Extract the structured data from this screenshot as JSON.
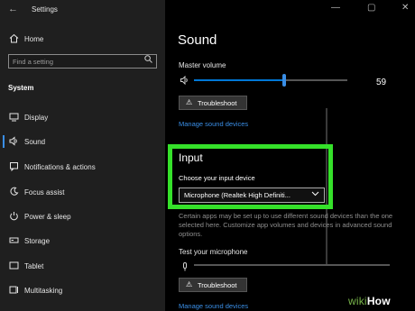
{
  "app": {
    "title": "Settings",
    "back_icon": "back-arrow-icon"
  },
  "window_controls": [
    "—",
    "▢",
    "✕"
  ],
  "sidebar": {
    "home": {
      "label": "Home",
      "icon": "home-icon"
    },
    "search": {
      "placeholder": "Find a setting",
      "icon": "search-icon"
    },
    "section_heading": "System",
    "items": [
      {
        "label": "Display",
        "icon": "display-icon",
        "active": false
      },
      {
        "label": "Sound",
        "icon": "speaker-icon",
        "active": true
      },
      {
        "label": "Notifications & actions",
        "icon": "notifications-icon",
        "active": false
      },
      {
        "label": "Focus assist",
        "icon": "focus-assist-icon",
        "active": false
      },
      {
        "label": "Power & sleep",
        "icon": "power-icon",
        "active": false
      },
      {
        "label": "Storage",
        "icon": "storage-icon",
        "active": false
      },
      {
        "label": "Tablet",
        "icon": "tablet-icon",
        "active": false
      },
      {
        "label": "Multitasking",
        "icon": "multitasking-icon",
        "active": false
      }
    ]
  },
  "main": {
    "title": "Sound",
    "master_volume": {
      "label": "Master volume",
      "value": "59",
      "level_percent": 59
    },
    "troubleshoot_label": "Troubleshoot",
    "manage_devices_label": "Manage sound devices",
    "input": {
      "heading": "Input",
      "choose_label": "Choose your input device",
      "selected_device": "Microphone (Realtek High Definiti...",
      "info_text": "Certain apps may be set up to use different sound devices than the one selected here. Customize app volumes and devices in advanced sound options.",
      "test_label": "Test your microphone"
    }
  },
  "colors": {
    "accent": "#0078d7",
    "highlight": "#35e12a",
    "sidebar_bg": "#1f1f1f"
  },
  "watermark": {
    "wiki": "wiki",
    "how": "How"
  }
}
